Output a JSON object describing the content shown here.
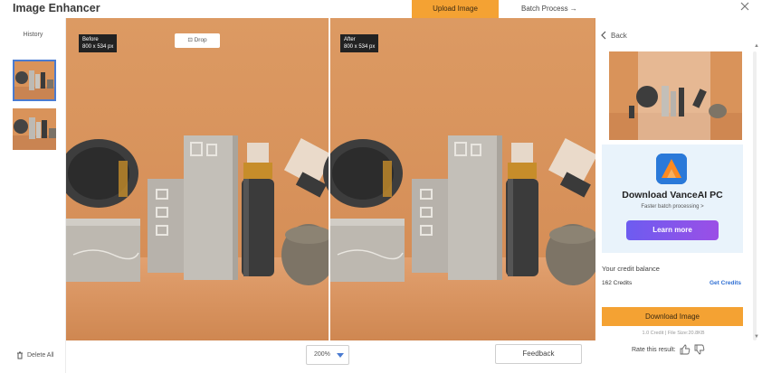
{
  "app": {
    "title": "Image Enhancer",
    "upload_label": "Upload Image",
    "batch_label": "Batch Process →"
  },
  "sidebar": {
    "history_label": "History",
    "thumbnails": [
      {
        "selected": true
      },
      {
        "selected": false
      }
    ],
    "delete_label": "Delete All"
  },
  "canvas": {
    "before": {
      "label": "Before",
      "resolution": "800 x 534 px"
    },
    "after": {
      "label": "After",
      "resolution": "800 x 534 px"
    },
    "crop_label": "⊡ Drop"
  },
  "bottombar": {
    "zoom_value": "200%",
    "feedback_label": "Feedback"
  },
  "right_panel": {
    "back_label": "Back",
    "ad": {
      "title": "Download VanceAI PC",
      "subtitle": "Faster batch processing >",
      "button_label": "Learn more"
    },
    "credit_label": "Your credit balance",
    "credit_count": "162 Credits",
    "get_credits_label": "Get Credits",
    "download_label": "Download Image",
    "credit_cost": "1.0 Credit | File Size:20.8KB",
    "rate_label": "Rate this result:"
  },
  "colors": {
    "accent_orange": "#f4a233",
    "background_peach": "#d9935a",
    "link_blue": "#2f6fd3"
  }
}
